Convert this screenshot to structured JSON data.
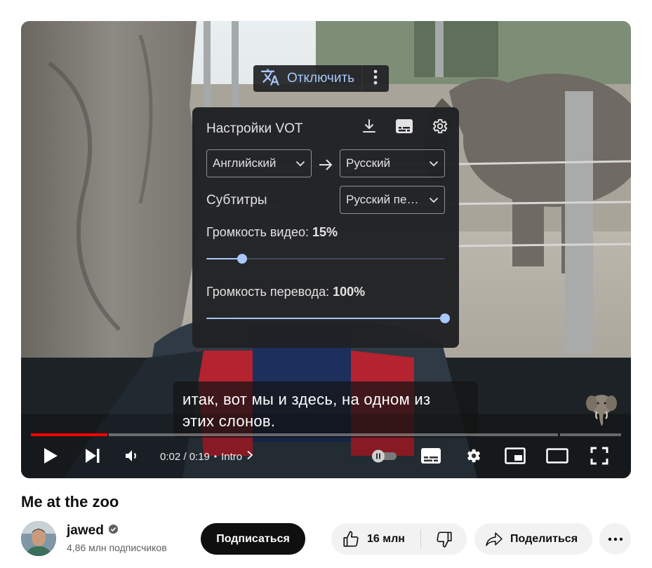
{
  "vot_button": {
    "label": "Отключить",
    "icon": "translate-icon",
    "more_icon": "more-vert-icon"
  },
  "vot_panel": {
    "title": "Настройки VOT",
    "icons": [
      "download-icon",
      "subtitles-icon",
      "gear-icon"
    ],
    "source_language": "Английский",
    "target_language": "Русский",
    "subtitles_label": "Субтитры",
    "subtitles_value": "Русский пе…",
    "video_volume_label": "Громкость видео:",
    "video_volume_value": "15%",
    "video_volume_level": 0.15,
    "translation_volume_label": "Громкость перевода:",
    "translation_volume_value": "100%",
    "translation_volume_level": 1.0
  },
  "subtitles": {
    "line1": "итак, вот мы и здесь, на одном из",
    "line2": "этих слонов."
  },
  "player": {
    "time": "0:02 / 0:19",
    "chapter_separator": "•",
    "chapter": "Intro",
    "progress_fraction": 0.13,
    "played_color": "#ff0000"
  },
  "video": {
    "title": "Me at the zoo",
    "channel": "jawed",
    "subscribers": "4,86 млн подписчиков",
    "subscribe_label": "Подписаться",
    "likes": "16 млн",
    "share_label": "Поделиться"
  },
  "colors": {
    "accent": "#a8c7fa",
    "panel_bg": "#202124"
  }
}
